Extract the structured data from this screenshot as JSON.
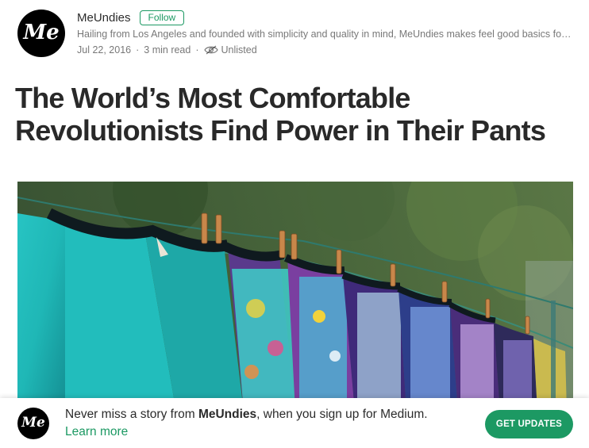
{
  "author": {
    "avatar_text": "Me",
    "name": "MeUndies",
    "follow_label": "Follow",
    "bio": "Hailing from Los Angeles and founded with simplicity and quality in mind, MeUndies makes feel good basics for everyone.",
    "date": "Jul 22, 2016",
    "read_time": "3 min read",
    "visibility": "Unlisted"
  },
  "article": {
    "title_line1": "The World’s Most Comfortable",
    "title_line2": "Revolutionists Find Power in Their Pants"
  },
  "banner": {
    "avatar_text": "Me",
    "message_prefix": "Never miss a story from ",
    "message_brand": "MeUndies",
    "message_suffix": ", when you sign up for Medium.",
    "learn_more": "Learn more",
    "cta": "GET UPDATES"
  },
  "colors": {
    "accent": "#1c9963",
    "text": "#212121"
  },
  "icons": {
    "unlisted": "eye-slash-icon"
  }
}
